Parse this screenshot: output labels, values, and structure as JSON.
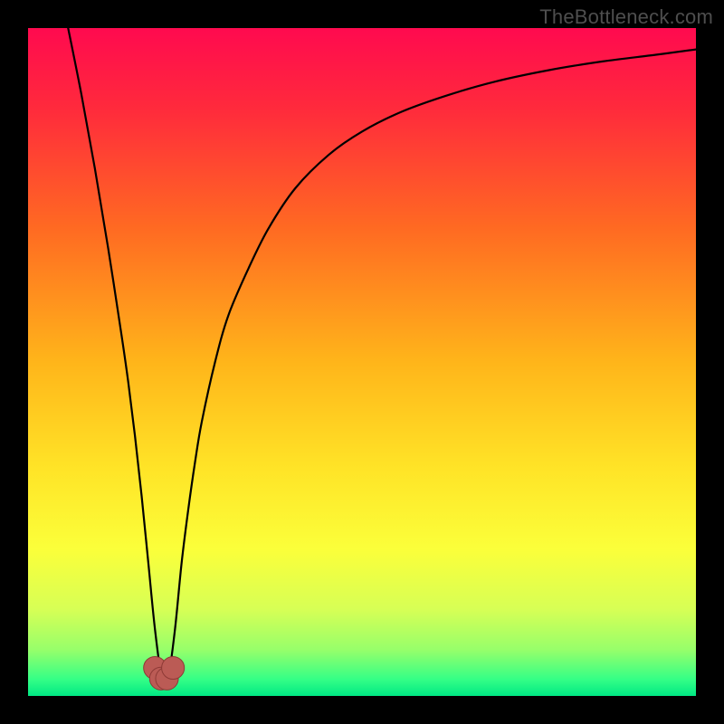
{
  "watermark": "TheBottleneck.com",
  "colors": {
    "frame": "#000000",
    "curve": "#000000",
    "marker_fill": "#bb5b55",
    "marker_stroke": "#8e3a36",
    "gradient_stops": [
      {
        "offset": 0.0,
        "color": "#ff0a4f"
      },
      {
        "offset": 0.12,
        "color": "#ff2a3c"
      },
      {
        "offset": 0.3,
        "color": "#ff6a22"
      },
      {
        "offset": 0.5,
        "color": "#ffb51a"
      },
      {
        "offset": 0.66,
        "color": "#ffe427"
      },
      {
        "offset": 0.78,
        "color": "#fbff3a"
      },
      {
        "offset": 0.87,
        "color": "#d7ff55"
      },
      {
        "offset": 0.93,
        "color": "#98ff6a"
      },
      {
        "offset": 0.975,
        "color": "#35ff86"
      },
      {
        "offset": 1.0,
        "color": "#00e884"
      }
    ]
  },
  "chart_data": {
    "type": "line",
    "title": "",
    "xlabel": "",
    "ylabel": "",
    "xlim": [
      0,
      100
    ],
    "ylim": [
      0,
      100
    ],
    "x_minimum": 20,
    "series": [
      {
        "name": "bottleneck-curve",
        "x": [
          6,
          8,
          10,
          12,
          14,
          15,
          16,
          17,
          18,
          19,
          20,
          21,
          22,
          23,
          24,
          25,
          26,
          28,
          30,
          33,
          36,
          40,
          45,
          50,
          56,
          63,
          70,
          78,
          86,
          94,
          100
        ],
        "y": [
          100,
          90,
          79,
          67,
          54,
          47,
          39,
          30,
          20,
          10,
          3,
          3,
          10,
          20,
          28,
          35,
          41,
          50,
          57,
          64,
          70,
          76,
          81,
          84.5,
          87.5,
          90,
          92,
          93.7,
          95,
          96,
          96.8
        ]
      }
    ],
    "markers": {
      "name": "minimum-cluster",
      "points": [
        {
          "x": 19.0,
          "y": 4.2
        },
        {
          "x": 19.9,
          "y": 2.6
        },
        {
          "x": 20.8,
          "y": 2.6
        },
        {
          "x": 21.7,
          "y": 4.2
        }
      ],
      "radius_pct": 1.7
    }
  }
}
